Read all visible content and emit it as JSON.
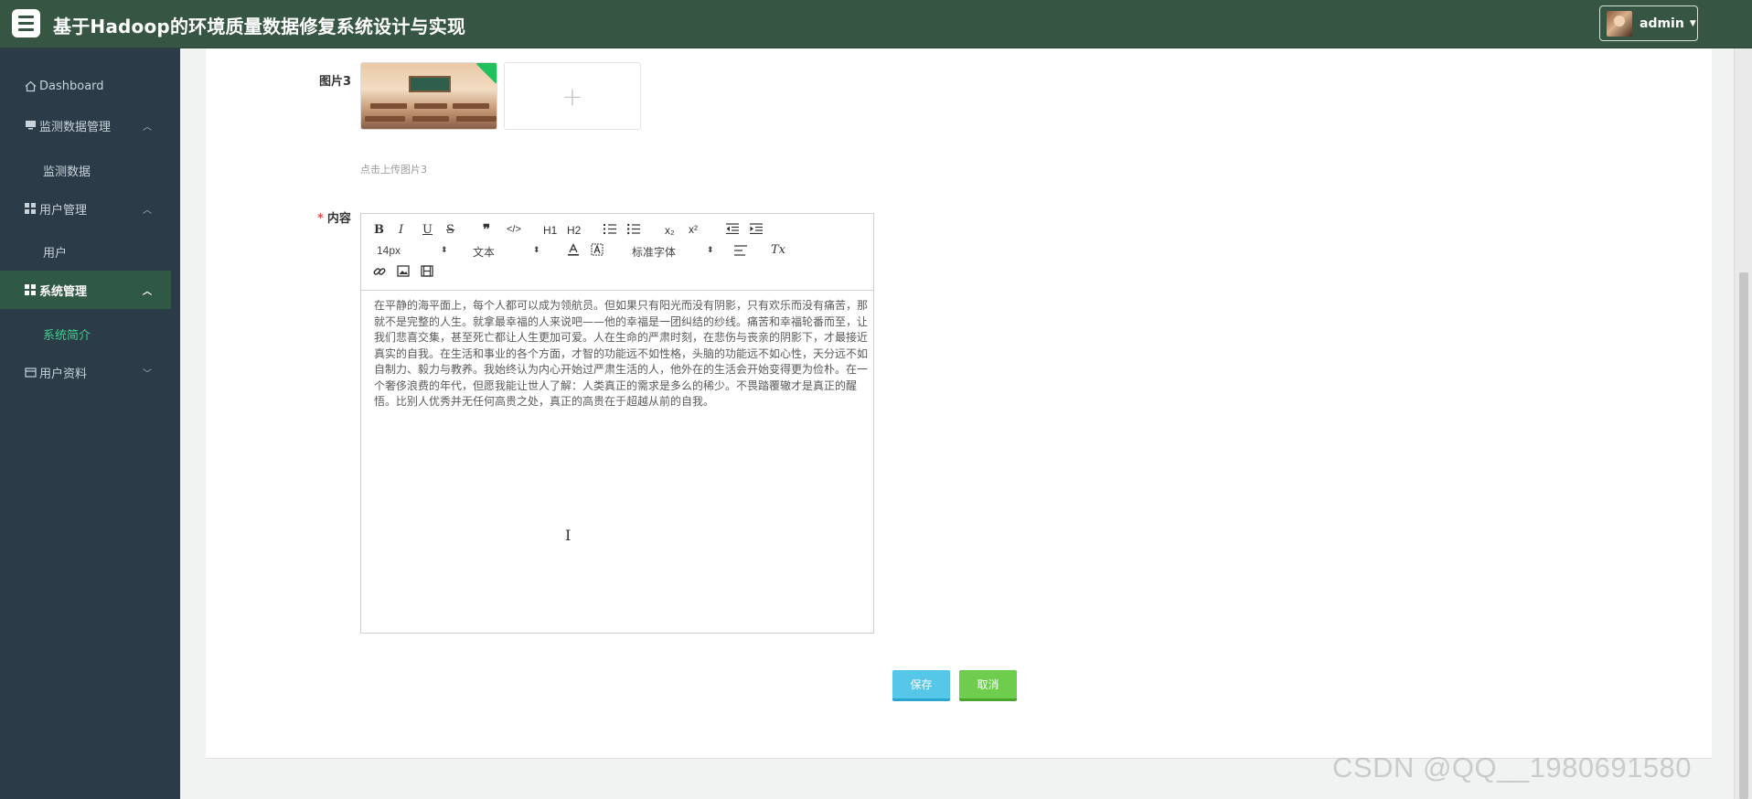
{
  "header": {
    "title": "基于Hadoop的环境质量数据修复系统设计与实现",
    "user": "admin"
  },
  "sidebar": {
    "items": [
      {
        "label": "Dashboard",
        "icon": "home-icon"
      },
      {
        "label": "监测数据管理",
        "icon": "monitor-icon",
        "expanded": true
      },
      {
        "label": "监测数据",
        "sub": true
      },
      {
        "label": "用户管理",
        "icon": "grid-icon",
        "expanded": true
      },
      {
        "label": "用户",
        "sub": true
      },
      {
        "label": "系统管理",
        "icon": "grid-icon",
        "expanded": true,
        "active": true
      },
      {
        "label": "系统简介",
        "sub": true,
        "active": true
      },
      {
        "label": "用户资料",
        "icon": "card-icon",
        "expanded": false
      }
    ]
  },
  "form": {
    "image3_label": "图片3",
    "upload_plus": "+",
    "upload_hint": "点击上传图片3",
    "content_required": "*",
    "content_label": "内容"
  },
  "editor": {
    "toolbar": {
      "bold": "B",
      "italic": "I",
      "underline": "U",
      "strike": "S",
      "blockquote": "❞",
      "code": "</>",
      "h1": "H1",
      "h2": "H2",
      "subscript": "x₂",
      "superscript": "x²",
      "size": "14px",
      "header": "文本",
      "font": "标准字体",
      "clean": "Tx"
    },
    "content": "在平静的海平面上，每个人都可以成为领航员。但如果只有阳光而没有阴影，只有欢乐而没有痛苦，那就不是完整的人生。就拿最幸福的人来说吧——他的幸福是一团纠结的纱线。痛苦和幸福轮番而至，让我们悲喜交集，甚至死亡都让人生更加可爱。人在生命的严肃时刻，在悲伤与丧亲的阴影下，才最接近真实的自我。在生活和事业的各个方面，才智的功能远不如性格，头脑的功能远不如心性，天分远不如自制力、毅力与教养。我始终认为内心开始过严肃生活的人，他外在的生活会开始变得更为俭朴。在一个奢侈浪费的年代，但愿我能让世人了解：人类真正的需求是多么的稀少。不畏踏覆辙才是真正的醒悟。比别人优秀并无任何高贵之处，真正的高贵在于超越从前的自我。"
  },
  "actions": {
    "save": "保存",
    "cancel": "取消"
  },
  "watermark": "CSDN @QQ__1980691580",
  "colors": {
    "header_bg": "#365543",
    "sidebar_bg": "#2b3c48",
    "sidebar_active_bg": "#2f5945",
    "sub_active_text": "#3fcf8a",
    "save_btn": "#56c7e8",
    "cancel_btn": "#6fcd4e"
  }
}
